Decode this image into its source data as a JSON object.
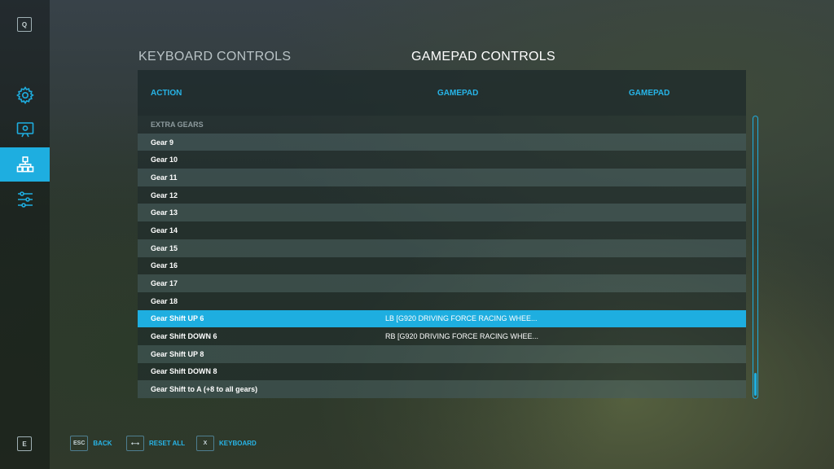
{
  "rail": {
    "top_key": "Q",
    "bottom_key": "E",
    "items": [
      {
        "icon": "gear-icon"
      },
      {
        "icon": "display-icon"
      },
      {
        "icon": "controls-icon",
        "active": true
      },
      {
        "icon": "sliders-icon"
      }
    ]
  },
  "tabs": {
    "keyboard": "KEYBOARD CONTROLS",
    "gamepad": "GAMEPAD CONTROLS",
    "active": "gamepad"
  },
  "table": {
    "headers": {
      "action": "ACTION",
      "gamepad1": "GAMEPAD",
      "gamepad2": "GAMEPAD"
    },
    "section": "EXTRA GEARS",
    "rows": [
      {
        "action": "Gear 9",
        "gamepad1": "",
        "gamepad2": ""
      },
      {
        "action": "Gear 10",
        "gamepad1": "",
        "gamepad2": ""
      },
      {
        "action": "Gear 11",
        "gamepad1": "",
        "gamepad2": ""
      },
      {
        "action": "Gear 12",
        "gamepad1": "",
        "gamepad2": ""
      },
      {
        "action": "Gear 13",
        "gamepad1": "",
        "gamepad2": ""
      },
      {
        "action": "Gear 14",
        "gamepad1": "",
        "gamepad2": ""
      },
      {
        "action": "Gear 15",
        "gamepad1": "",
        "gamepad2": ""
      },
      {
        "action": "Gear 16",
        "gamepad1": "",
        "gamepad2": ""
      },
      {
        "action": "Gear 17",
        "gamepad1": "",
        "gamepad2": ""
      },
      {
        "action": "Gear 18",
        "gamepad1": "",
        "gamepad2": ""
      },
      {
        "action": "Gear Shift UP 6",
        "gamepad1": "LB [G920 DRIVING FORCE RACING WHEE...",
        "gamepad2": "",
        "selected": true
      },
      {
        "action": "Gear Shift DOWN 6",
        "gamepad1": "RB [G920 DRIVING FORCE RACING WHEE...",
        "gamepad2": ""
      },
      {
        "action": "Gear Shift UP 8",
        "gamepad1": "",
        "gamepad2": ""
      },
      {
        "action": "Gear Shift DOWN 8",
        "gamepad1": "",
        "gamepad2": ""
      },
      {
        "action": "Gear Shift to A (+8 to all gears)",
        "gamepad1": "",
        "gamepad2": ""
      }
    ]
  },
  "footer": {
    "back": {
      "key": "ESC",
      "label": "BACK"
    },
    "reset": {
      "key": "⟷",
      "label": "RESET ALL"
    },
    "keyboard": {
      "key": "X",
      "label": "KEYBOARD"
    }
  },
  "colors": {
    "accent": "#1eaee0",
    "header_text": "#27b5e8"
  }
}
